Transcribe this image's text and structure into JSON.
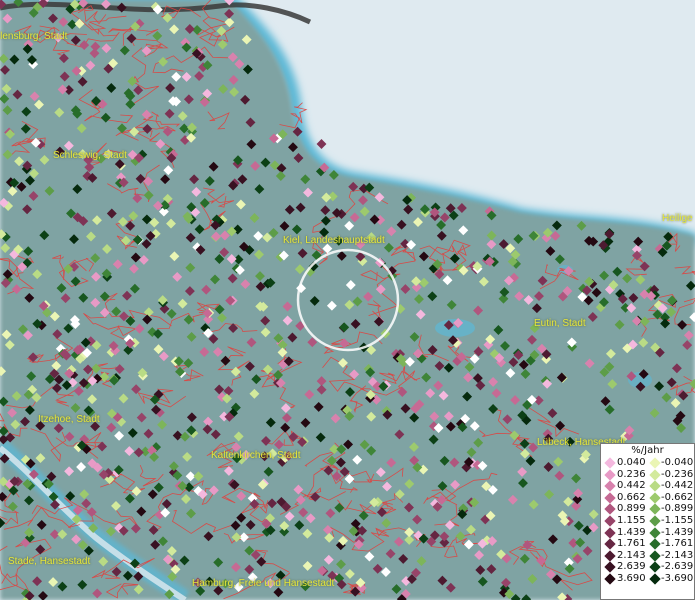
{
  "cities": [
    {
      "name": "Flensburg, Stadt",
      "pos": "flensburg"
    },
    {
      "name": "Schleswig, Stadt",
      "pos": "schleswig"
    },
    {
      "name": "Kiel, Landeshauptstadt",
      "pos": "kiel"
    },
    {
      "name": "Eutin, Stadt",
      "pos": "eutin"
    },
    {
      "name": "Itzehoe, Stadt",
      "pos": "itzehoe"
    },
    {
      "name": "Kaltenkirchen, Stadt",
      "pos": "kaltenkirchen"
    },
    {
      "name": "Lübeck, Hansestadt",
      "pos": "luebeck"
    },
    {
      "name": "Stade, Hansestadt",
      "pos": "stade"
    },
    {
      "name": "Hamburg, Freie und Hansestadt",
      "pos": "hamburg"
    },
    {
      "name": "Heilige",
      "pos": "heilige"
    }
  ],
  "legend": {
    "title": "%/Jahr",
    "positive": [
      {
        "label": "0.040",
        "color": "#f4b8de"
      },
      {
        "label": "0.236",
        "color": "#e89ac6"
      },
      {
        "label": "0.442",
        "color": "#d882ad"
      },
      {
        "label": "0.662",
        "color": "#c66a94"
      },
      {
        "label": "0.899",
        "color": "#b0567e"
      },
      {
        "label": "1.155",
        "color": "#974469"
      },
      {
        "label": "1.439",
        "color": "#7e3355"
      },
      {
        "label": "1.761",
        "color": "#652642"
      },
      {
        "label": "2.143",
        "color": "#4d1a30"
      },
      {
        "label": "2.639",
        "color": "#381121"
      },
      {
        "label": "3.690",
        "color": "#240912"
      }
    ],
    "negative": [
      {
        "label": "-0.040",
        "color": "#eaf5b4"
      },
      {
        "label": "-0.236",
        "color": "#d3ea9c"
      },
      {
        "label": "-0.442",
        "color": "#b9db85"
      },
      {
        "label": "-0.662",
        "color": "#9dca6d"
      },
      {
        "label": "-0.899",
        "color": "#7db55a"
      },
      {
        "label": "-1.155",
        "color": "#5d9d48"
      },
      {
        "label": "-1.439",
        "color": "#3f8538"
      },
      {
        "label": "-1.761",
        "color": "#276d2a"
      },
      {
        "label": "-2.143",
        "color": "#17561f"
      },
      {
        "label": "-2.639",
        "color": "#0c4016"
      },
      {
        "label": "-3.690",
        "color": "#052a0d"
      }
    ]
  },
  "colors": {
    "water": "#dfeaf0",
    "land": "#7fa3a3",
    "coast_glow": "#5cb8d6",
    "boundary": "#e0423f",
    "city_label": "#e6e63a",
    "highlight_ring": "#ffffff"
  }
}
